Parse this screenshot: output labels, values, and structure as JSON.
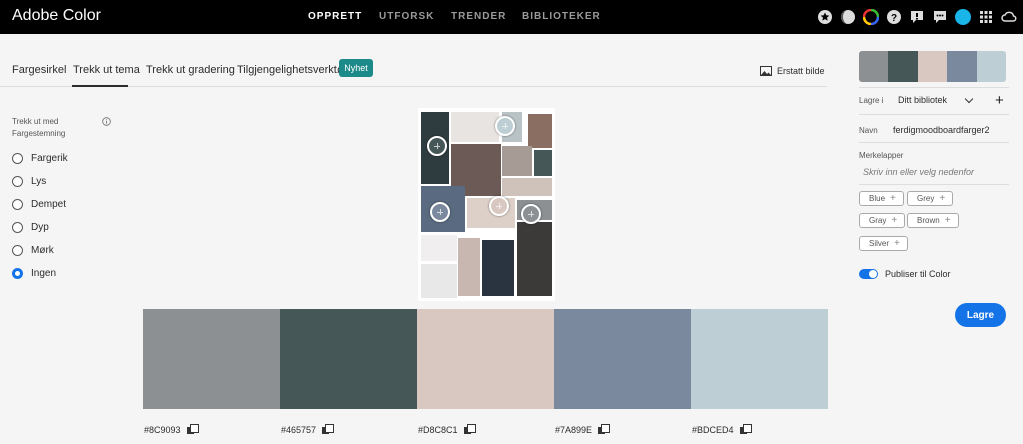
{
  "app": {
    "title": "Adobe Color"
  },
  "nav": [
    "OPPRETT",
    "UTFORSK",
    "TRENDER",
    "BIBLIOTEKER"
  ],
  "top_icons": [
    "star-icon",
    "moon-icon",
    "color-wheel-icon",
    "help-icon",
    "feedback-icon",
    "chat-icon",
    "avatar",
    "apps-grid-icon",
    "creative-cloud-icon"
  ],
  "tabs": [
    "Fargesirkel",
    "Trekk ut tema",
    "Trekk ut gradering",
    "Tilgjengelighetsverktøy"
  ],
  "badge": "Nyhet",
  "replace_image": "Erstatt bilde",
  "mood": {
    "title": "Trekk ut med Fargestemning",
    "options": [
      "Fargerik",
      "Lys",
      "Dempet",
      "Dyp",
      "Mørk",
      "Ingen"
    ],
    "selected": "Ingen"
  },
  "swatches": [
    {
      "hex": "#8C9093",
      "color": "#8c9093"
    },
    {
      "hex": "#465757",
      "color": "#465757"
    },
    {
      "hex": "#D8C8C1",
      "color": "#d8c8c1"
    },
    {
      "hex": "#7A899E",
      "color": "#7a899e"
    },
    {
      "hex": "#BDCED4",
      "color": "#bdced4"
    }
  ],
  "panel": {
    "save_in_label": "Lagre i",
    "library": "Ditt bibliotek",
    "name_label": "Navn",
    "name_value": "ferdigmoodboardfarger2",
    "tags_label": "Merkelapper",
    "tags_placeholder": "Skriv inn eller velg nedenfor",
    "tags": [
      "Blue",
      "Grey",
      "Gray",
      "Brown",
      "Silver"
    ],
    "publish_label": "Publiser til Color",
    "publish_on": true,
    "save_button": "Lagre"
  }
}
